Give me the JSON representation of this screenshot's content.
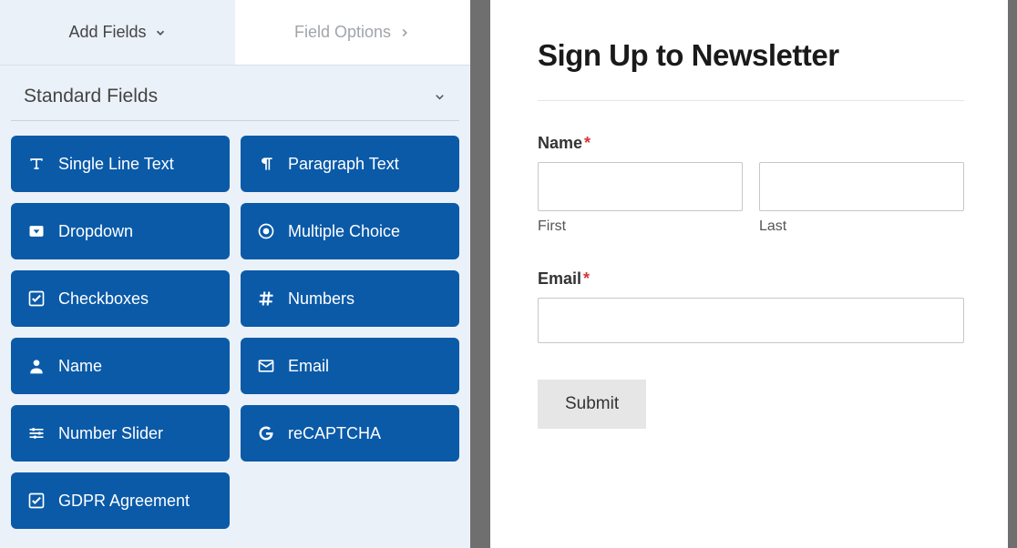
{
  "tabs": {
    "add_fields": "Add Fields",
    "field_options": "Field Options"
  },
  "section": {
    "title": "Standard Fields"
  },
  "fields": [
    {
      "name": "single-line-text",
      "label": "Single Line Text",
      "icon": "text"
    },
    {
      "name": "paragraph-text",
      "label": "Paragraph Text",
      "icon": "paragraph"
    },
    {
      "name": "dropdown",
      "label": "Dropdown",
      "icon": "dropdown"
    },
    {
      "name": "multiple-choice",
      "label": "Multiple Choice",
      "icon": "radio"
    },
    {
      "name": "checkboxes",
      "label": "Checkboxes",
      "icon": "check"
    },
    {
      "name": "numbers",
      "label": "Numbers",
      "icon": "hash"
    },
    {
      "name": "name",
      "label": "Name",
      "icon": "user"
    },
    {
      "name": "email",
      "label": "Email",
      "icon": "mail"
    },
    {
      "name": "number-slider",
      "label": "Number Slider",
      "icon": "sliders"
    },
    {
      "name": "recaptcha",
      "label": "reCAPTCHA",
      "icon": "google"
    },
    {
      "name": "gdpr-agreement",
      "label": "GDPR Agreement",
      "icon": "check"
    }
  ],
  "preview": {
    "title": "Sign Up to Newsletter",
    "name_label": "Name",
    "first_sub": "First",
    "last_sub": "Last",
    "email_label": "Email",
    "submit_label": "Submit",
    "required_marker": "*"
  },
  "colors": {
    "field_button_bg": "#0a5aa8",
    "panel_bg": "#ebf1f8",
    "required": "#d63638"
  }
}
